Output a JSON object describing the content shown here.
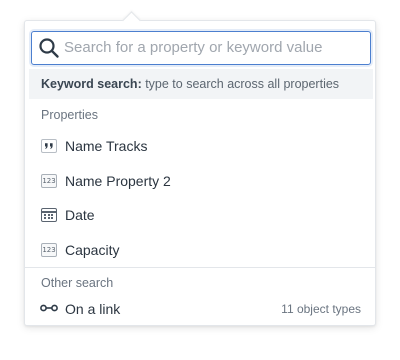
{
  "search": {
    "value": "",
    "placeholder": "Search for a property or keyword value"
  },
  "hint": {
    "bold": "Keyword search:",
    "text": " type to search across all properties"
  },
  "properties": {
    "heading": "Properties",
    "items": [
      {
        "label": "Name Tracks",
        "icon": "quote-icon",
        "glyph": "99"
      },
      {
        "label": "Name Property 2",
        "icon": "number-icon",
        "glyph": "123"
      },
      {
        "label": "Date",
        "icon": "calendar-icon",
        "glyph": ""
      },
      {
        "label": "Capacity",
        "icon": "number-icon",
        "glyph": "123"
      }
    ]
  },
  "other": {
    "heading": "Other search",
    "link": {
      "label": "On a link",
      "count": "11 object types",
      "icon": "link-icon"
    }
  },
  "colors": {
    "accent": "#4c7fcf",
    "text": "#2b3540",
    "muted": "#6a7480",
    "hint_bg": "#f2f4f6"
  }
}
